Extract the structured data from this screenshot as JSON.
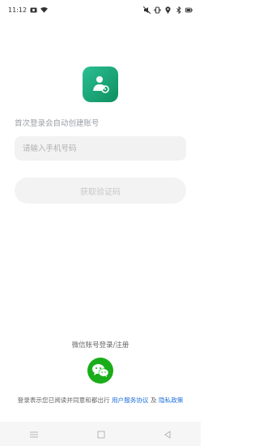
{
  "status_bar": {
    "time": "11:12",
    "left_icons": [
      "camera-icon",
      "wifi-icon"
    ],
    "right_icons": [
      "mute-icon",
      "vibrate-icon",
      "location-icon",
      "bluetooth-icon",
      "battery-icon"
    ]
  },
  "brand": {
    "logo_icon": "driver-profile-icon",
    "accent": "#1aa577"
  },
  "login": {
    "hint": "首次登录会自动创建账号",
    "phone_placeholder": "请输入手机号码",
    "phone_value": "",
    "get_code_label": "获取验证码"
  },
  "wechat": {
    "title": "微信账号登录/注册",
    "icon": "wechat-icon",
    "color": "#1aad19"
  },
  "agreement": {
    "prefix": "登录表示您已阅读并同意和都出行",
    "user_agreement": "用户服务协议",
    "and": "及",
    "privacy_policy": "隐私政策",
    "link_color": "#1e6fd9"
  },
  "nav": {
    "items": [
      "menu-icon",
      "home-icon",
      "back-icon"
    ]
  }
}
